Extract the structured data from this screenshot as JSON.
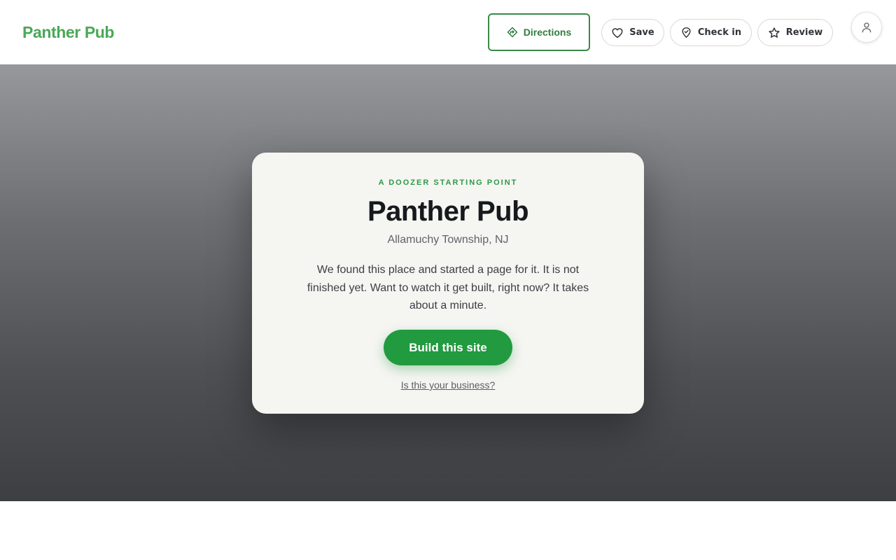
{
  "header": {
    "brand": "Panther Pub",
    "directions_label": "Directions",
    "save_label": "Save",
    "checkin_label": "Check in",
    "review_label": "Review",
    "icons": {
      "directions": "directions-icon",
      "save": "heart-icon",
      "checkin": "map-pin-icon",
      "review": "star-icon",
      "account": "user-icon"
    }
  },
  "hero": {
    "eyebrow": "A DOOZER STARTING POINT",
    "title": "Panther Pub",
    "location": "Allamuchy Township, NJ",
    "description": "We found this place and started a page for it. It is not finished yet. Want to watch it get built, right now? It takes about a minute.",
    "cta_label": "Build this site",
    "business_link": "Is this your business?"
  },
  "colors": {
    "brand_green": "#4aa858",
    "primary_green": "#229a3f",
    "directions_border": "#3a8a48",
    "card_bg": "#f5f5f2",
    "hero_top": "#97989b",
    "hero_bottom": "#3d3f43"
  }
}
